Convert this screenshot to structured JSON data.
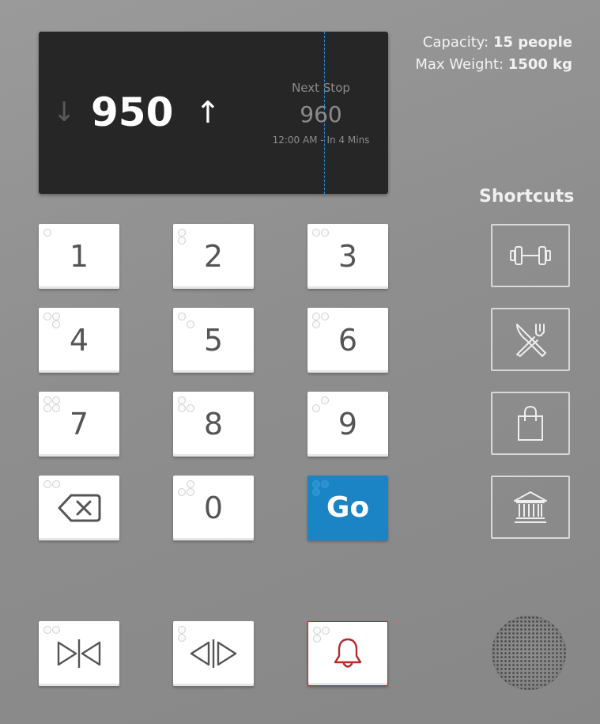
{
  "display": {
    "current_floor": "950",
    "down_arrow": "↓",
    "up_arrow": "↑",
    "next_stop_label": "Next Stop",
    "next_stop_floor": "960",
    "next_stop_time": "12:00 AM - In 4 Mins"
  },
  "info": {
    "capacity_label": "Capacity:",
    "capacity_value": "15 people",
    "max_weight_label": "Max Weight:",
    "max_weight_value": "1500 kg"
  },
  "shortcuts": {
    "title": "Shortcuts",
    "items": [
      "gym-icon",
      "restaurant-icon",
      "shopping-bag-icon",
      "bank-icon"
    ]
  },
  "keypad": {
    "keys": [
      "1",
      "2",
      "3",
      "4",
      "5",
      "6",
      "7",
      "8",
      "9",
      "0"
    ],
    "go_label": "Go",
    "backspace_icon": "backspace-icon",
    "close_doors_icon": "close-doors-icon",
    "open_doors_icon": "open-doors-icon",
    "alarm_icon": "alarm-bell-icon"
  },
  "colors": {
    "go_button": "#1a84c4",
    "alarm_border": "#b52a2a",
    "display_bg": "#262626",
    "divider": "#2e8fcf"
  }
}
